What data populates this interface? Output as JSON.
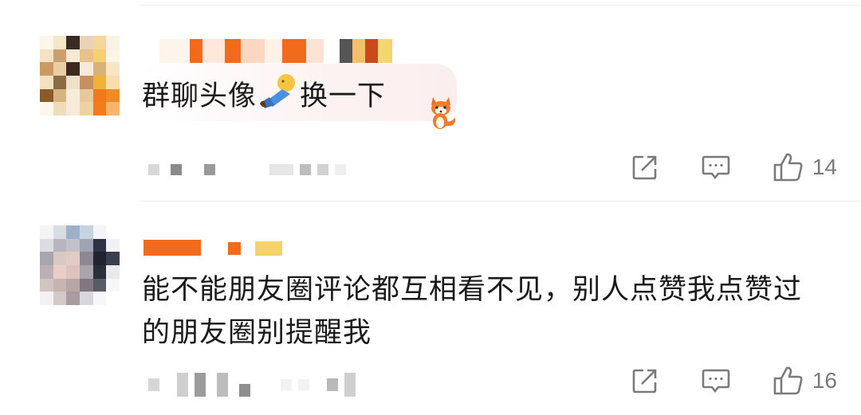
{
  "comments": [
    {
      "text_before_emoji": "群聊头像",
      "text_after_emoji": "换一下",
      "emoji_icon": "person-sleeping-icon",
      "sticker_icon": "fox-sticker-icon",
      "share_label": "",
      "comment_label": "",
      "like_count": "14"
    },
    {
      "text_line_1": "能不能朋友圈评论都互相看不见，别人点赞我点赞过",
      "text_line_2": "的朋友圈别提醒我",
      "like_count": "16"
    }
  ],
  "colors": {
    "accent_orange": "#f26a1b",
    "icon_gray": "#7a7a7a",
    "divider": "#ececec"
  }
}
